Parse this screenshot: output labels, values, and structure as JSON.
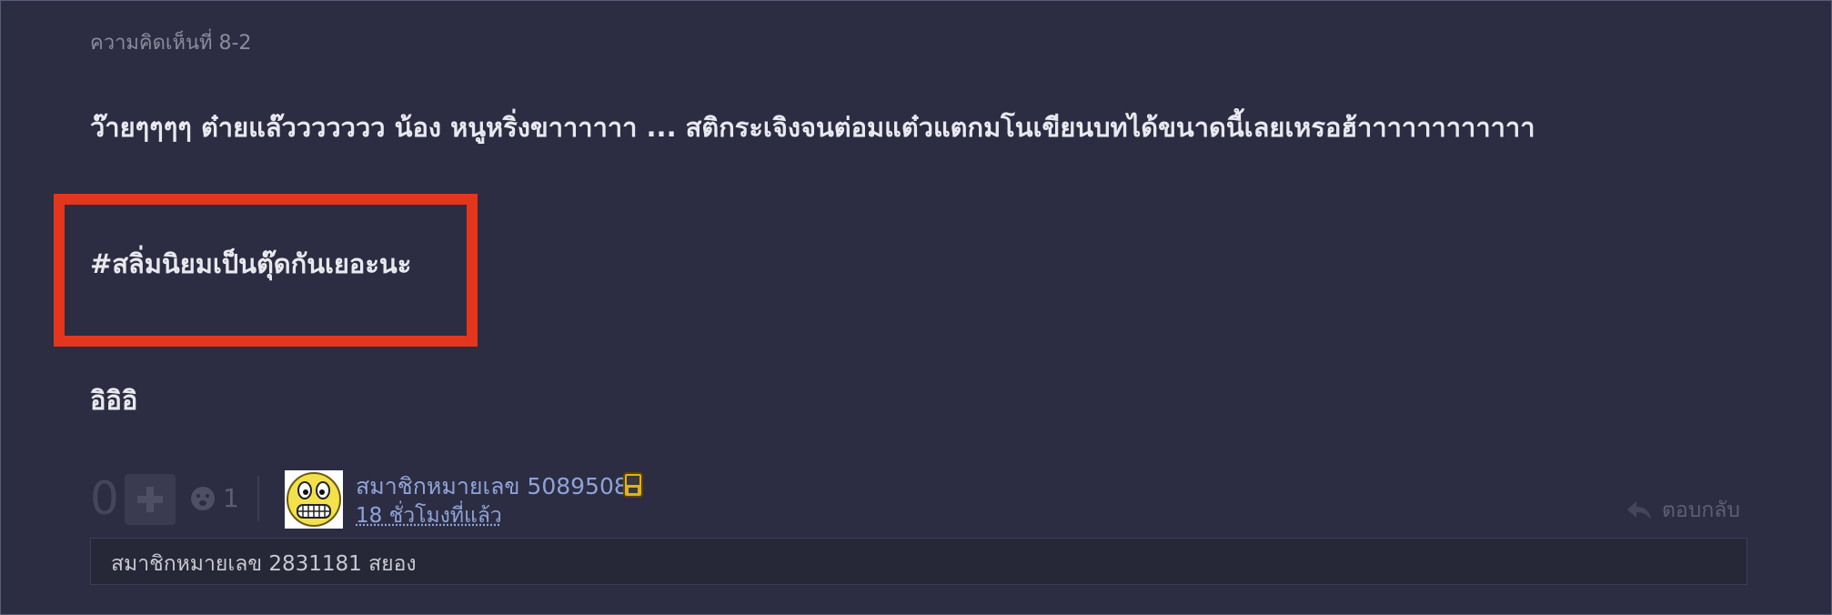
{
  "comment": {
    "header": "ความคิดเห็นที่ 8-2",
    "line1": "ว๊ายๆๆๆๆ  ต๋ายแล๊ววววววว น้อง หนูหริ่งขาาาาาา  ... สติกระเจิงจนต่อมแต๋วแตกมโนเขียนบทได้ขนาดนี้เลยเหรอฮ้าาาาาาาาาาาา",
    "hashtag": "#สลิ่มนิยมเป็นตุ๊ดกันเยอะนะ",
    "line3": "อิอิอิ"
  },
  "votes": {
    "count": "0",
    "emotion_count": "1"
  },
  "author": {
    "username": "สมาชิกหมายเลข 5089508",
    "timestamp": "18 ชั่วโมงที่แล้ว"
  },
  "reply_label": "ตอบกลับ",
  "sub_comment": "สมาชิกหมายเลข 2831181 สยอง",
  "colors": {
    "background": "#2c2d42",
    "highlight": "#e4351d",
    "link": "#8fa3d8"
  }
}
